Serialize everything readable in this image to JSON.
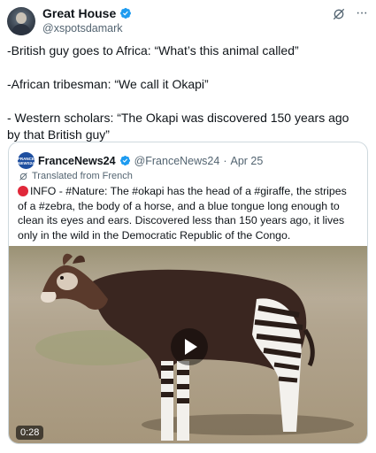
{
  "author": {
    "display_name": "Great House",
    "handle": "@xspotsdamark",
    "verified_icon": "verified-badge-icon",
    "grok_icon": "grok-icon",
    "more_icon": "more-options-icon",
    "more_glyph": "···"
  },
  "tweet": {
    "lines": [
      "-British guy goes to Africa: “What’s this animal called”",
      "-African tribesman: “We call it Okapi”",
      "- Western scholars: “The Okapi was discovered 150 years ago by that British guy”"
    ]
  },
  "quote": {
    "avatar_text": "FRANCE NEWS24",
    "display_name": "FranceNews24",
    "handle": "@FranceNews24",
    "separator": "·",
    "date": "Apr 25",
    "translated_label": "Translated from French",
    "text": "INFO - #Nature: The #okapi has the head of a #giraffe, the stripes of a #zebra, the body of a horse, and a blue tongue long enough to clean its eyes and ears. Discovered less than 150 years ago, it lives only in the wild in the Democratic Republic of the Congo.",
    "video_duration": "0:28"
  },
  "colors": {
    "text": "#0f1419",
    "muted": "#536471",
    "verified": "#1d9bf0",
    "border": "#cfd9de",
    "info_dot": "#e0283a"
  }
}
